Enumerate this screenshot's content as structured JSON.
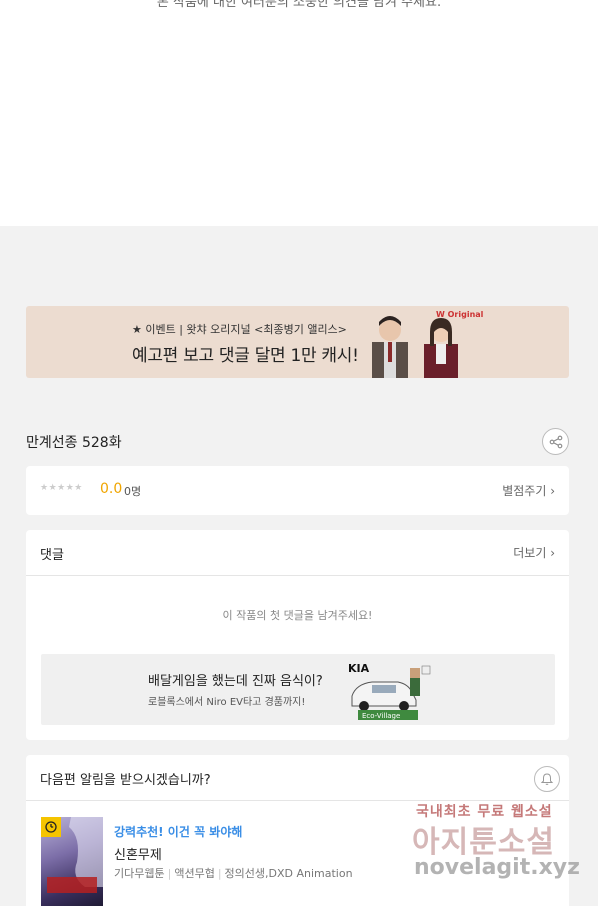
{
  "top": {
    "cut_text": "본 작품에 대한 여러분의 소중한 의견을 남겨 주세요."
  },
  "banner": {
    "line1": "★ 이벤트 | 왓챠 오리지널 <최종병기 앨리스>",
    "line2": "예고편 보고 댓글 달면 1만 캐시!",
    "brand": "W Original"
  },
  "episode": {
    "title": "만계선종 528화"
  },
  "rating": {
    "stars": "★★★★★",
    "score": "0.0",
    "count": "0명",
    "rate_link": "별점주기 ›"
  },
  "comments": {
    "header": "댓글",
    "more_link": "더보기 ›",
    "empty_message": "이 작품의 첫 댓글을 남겨주세요!"
  },
  "ad": {
    "title": "배달게임을 했는데 진짜 음식이?",
    "subtitle": "로블록스에서 Niro EV타고 경품까지!",
    "brand": "KIA",
    "badge": "Eco-Village"
  },
  "notify": {
    "header": "다음편 알림을 받으시겠습니까?",
    "rec_label": "강력추천! 이건 꼭 봐야해",
    "novel_title": "신혼무제",
    "meta": [
      "기다무웹툰",
      "액션무협",
      "정의선생,DXD Animation"
    ]
  },
  "watermark": {
    "line1": "국내최초 무료 웹소설",
    "line2": "아지툰소설",
    "line3": "novelagit.xyz"
  },
  "colors": {
    "accent_score": "#f0a500",
    "rec_blue": "#3a8ee6",
    "banner_bg": "#ecdcd0",
    "page_bg": "#f2f2f2"
  }
}
